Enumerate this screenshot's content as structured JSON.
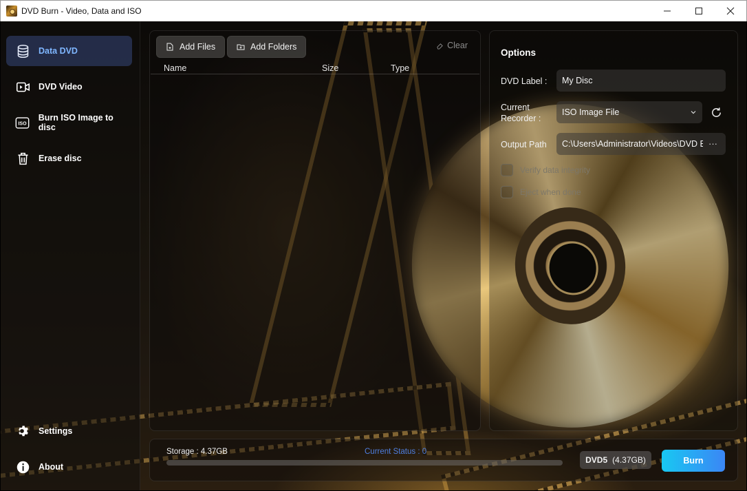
{
  "window": {
    "title": "DVD Burn - Video, Data and ISO",
    "controls": [
      "minimize-icon",
      "maximize-icon",
      "close-icon"
    ]
  },
  "sidebar": {
    "items": [
      {
        "label": "Data DVD",
        "icon": "database-icon",
        "active": true
      },
      {
        "label": "DVD Video",
        "icon": "video-icon",
        "active": false
      },
      {
        "label": "Burn ISO Image to disc",
        "icon": "iso-icon",
        "active": false
      },
      {
        "label": "Erase disc",
        "icon": "trash-icon",
        "active": false
      }
    ],
    "footer": [
      {
        "label": "Settings",
        "icon": "gear-icon"
      },
      {
        "label": "About",
        "icon": "info-icon"
      }
    ]
  },
  "files": {
    "add_files_label": "Add Files",
    "add_folders_label": "Add Folders",
    "clear_label": "Clear",
    "columns": [
      "Name",
      "Size",
      "Type"
    ],
    "rows": []
  },
  "options": {
    "title": "Options",
    "dvd_label": {
      "label": "DVD Label :",
      "value": "My Disc"
    },
    "recorder": {
      "label_line1": "Current",
      "label_line2": "Recorder :",
      "value": "ISO Image File"
    },
    "output_path": {
      "label": "Output Path",
      "value": "C:\\Users\\Administrator\\Videos\\DVD B"
    },
    "verify_label": "Verify data integrity",
    "eject_label": "Eject when done"
  },
  "status": {
    "storage_label": "Storage :",
    "storage_value": "4.37GB",
    "current_status_label": "Current Status :",
    "current_status_value": "0",
    "progress": 0,
    "disc_type": "DVD5",
    "disc_capacity": "(4.37GB)",
    "burn_label": "Burn"
  },
  "colors": {
    "accent_blue": "#7fb6ff",
    "status_blue": "#4f7fe0",
    "burn_gradient_start": "#18c8f2",
    "burn_gradient_end": "#3b86f5"
  }
}
